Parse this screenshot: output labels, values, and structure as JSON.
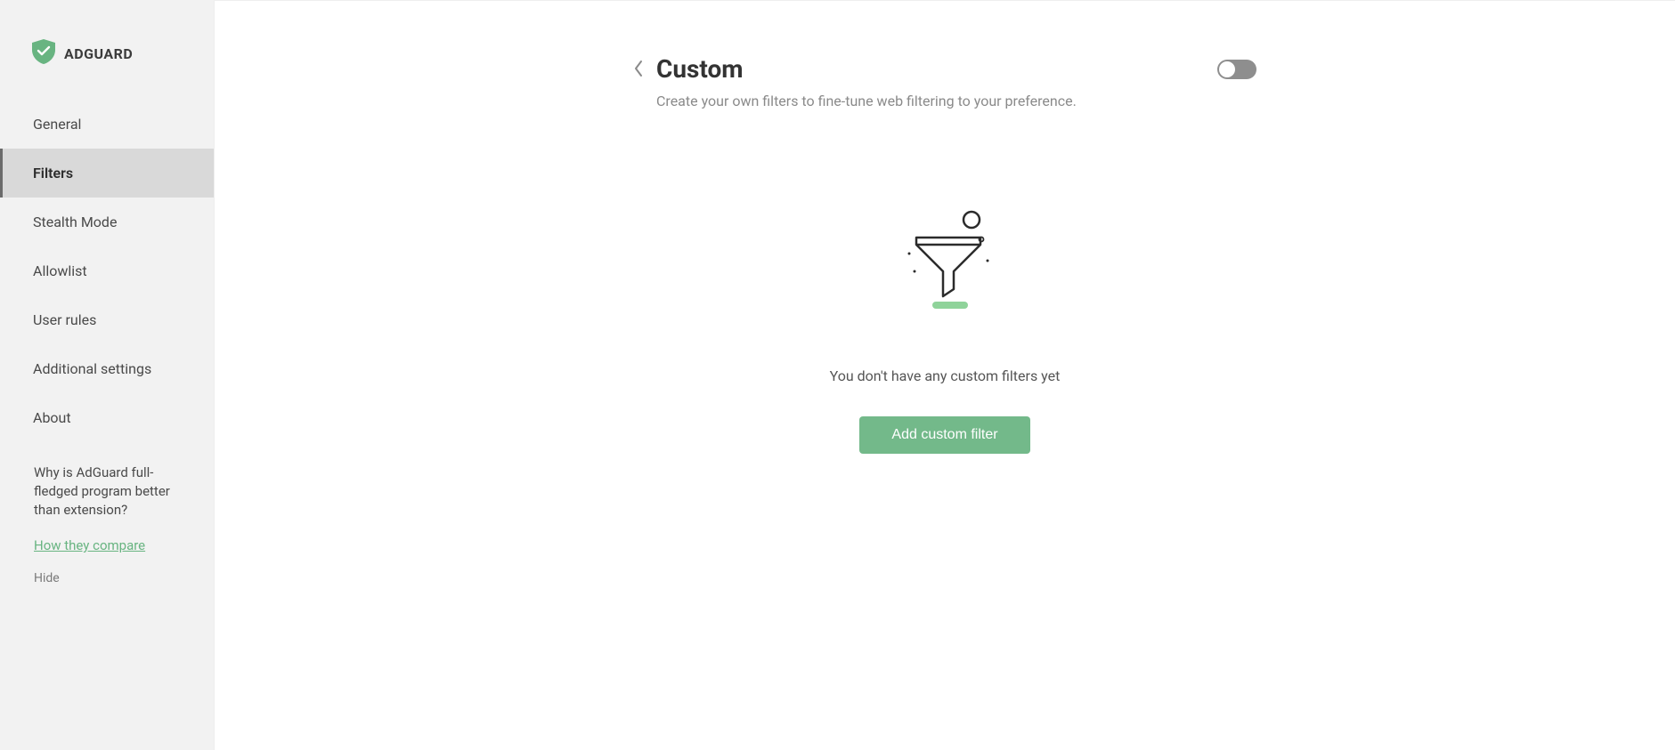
{
  "brand": {
    "name": "ADGUARD"
  },
  "sidebar": {
    "items": [
      {
        "label": "General"
      },
      {
        "label": "Filters"
      },
      {
        "label": "Stealth Mode"
      },
      {
        "label": "Allowlist"
      },
      {
        "label": "User rules"
      },
      {
        "label": "Additional settings"
      },
      {
        "label": "About"
      }
    ],
    "promo_text": "Why is AdGuard full-fledged program better than extension?",
    "promo_link": "How they compare",
    "promo_hide": "Hide"
  },
  "page": {
    "title": "Custom",
    "description": "Create your own filters to fine-tune web filtering to your preference.",
    "toggle_on": false
  },
  "empty": {
    "message": "You don't have any custom filters yet",
    "button": "Add custom filter"
  },
  "colors": {
    "accent": "#68b481",
    "button": "#73b98a",
    "sidebar_bg": "#f2f2f2",
    "text_muted": "#8a8a8a"
  }
}
